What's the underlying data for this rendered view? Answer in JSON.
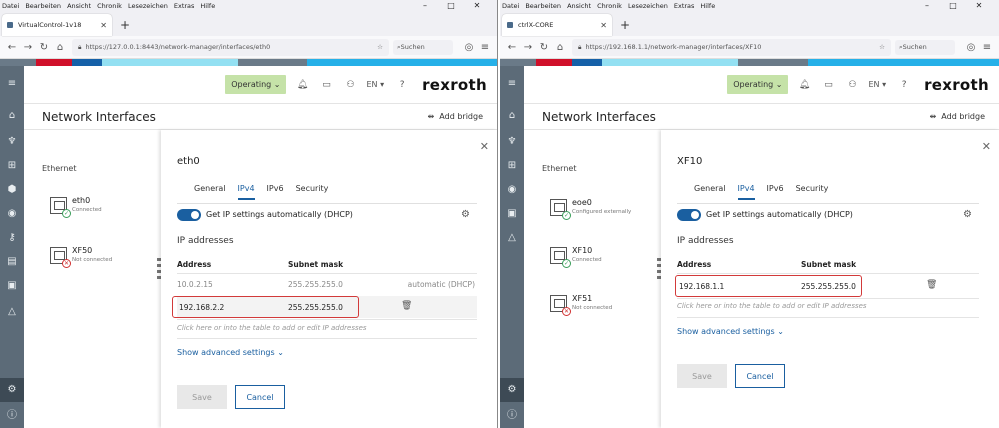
{
  "browser": {
    "menu": [
      "Datei",
      "Bearbeiten",
      "Ansicht",
      "Chronik",
      "Lesezeichen",
      "Extras",
      "Hilfe"
    ],
    "window_controls": [
      "–",
      "□",
      "✕"
    ],
    "new_tab": "+",
    "search_placeholder": "Suchen"
  },
  "left": {
    "tab_title": "VirtualControl-1v18",
    "url": "https://127.0.0.1:8443/network-manager/interfaces/eth0",
    "operating": "Operating",
    "lang": "EN",
    "logo": "rexroth",
    "page_title": "Network Interfaces",
    "add_bridge": "Add bridge",
    "ethernet_label": "Ethernet",
    "interfaces": [
      {
        "name": "eth0",
        "status": "Connected",
        "state": "ok"
      },
      {
        "name": "XF50",
        "status": "Not connected",
        "state": "bad"
      }
    ],
    "panel_title": "eth0",
    "tabs": [
      "General",
      "IPv4",
      "IPv6",
      "Security"
    ],
    "active_tab": "IPv4",
    "dhcp_label": "Get IP settings automatically (DHCP)",
    "ip_header": "IP addresses",
    "col_address": "Address",
    "col_mask": "Subnet mask",
    "rows": [
      {
        "address": "10.0.2.15",
        "mask": "255.255.255.0",
        "note": "automatic (DHCP)"
      },
      {
        "address": "192.168.2.2",
        "mask": "255.255.255.0",
        "note": ""
      }
    ],
    "hint": "Click here or into the table to add or edit IP addresses",
    "advanced": "Show advanced settings",
    "save": "Save",
    "cancel": "Cancel"
  },
  "right": {
    "tab_title": "ctrlX-CORE",
    "url": "https://192.168.1.1/network-manager/interfaces/XF10",
    "operating": "Operating",
    "lang": "EN",
    "logo": "rexroth",
    "page_title": "Network Interfaces",
    "add_bridge": "Add bridge",
    "ethernet_label": "Ethernet",
    "interfaces": [
      {
        "name": "eoe0",
        "status": "Configured externally",
        "state": "ok"
      },
      {
        "name": "XF10",
        "status": "Connected",
        "state": "ok"
      },
      {
        "name": "XF51",
        "status": "Not connected",
        "state": "bad"
      }
    ],
    "panel_title": "XF10",
    "tabs": [
      "General",
      "IPv4",
      "IPv6",
      "Security"
    ],
    "active_tab": "IPv4",
    "dhcp_label": "Get IP settings automatically (DHCP)",
    "ip_header": "IP addresses",
    "col_address": "Address",
    "col_mask": "Subnet mask",
    "rows": [
      {
        "address": "192.168.1.1",
        "mask": "255.255.255.0",
        "note": ""
      }
    ],
    "hint": "Click here or into the table to add or edit IP addresses",
    "advanced": "Show advanced settings",
    "save": "Save",
    "cancel": "Cancel"
  },
  "colors": {
    "accent": "#1a5fa0",
    "operating_bg": "#c5e2a8",
    "sidebar": "#5c6b78",
    "highlight": "#d23a3a"
  },
  "icons": [
    "reload-icon",
    "back-icon",
    "forward-icon",
    "bell-icon",
    "folder-icon",
    "user-icon",
    "help-icon",
    "gear-icon",
    "trash-icon",
    "close-icon",
    "home-icon",
    "settings-icon",
    "info-icon"
  ]
}
